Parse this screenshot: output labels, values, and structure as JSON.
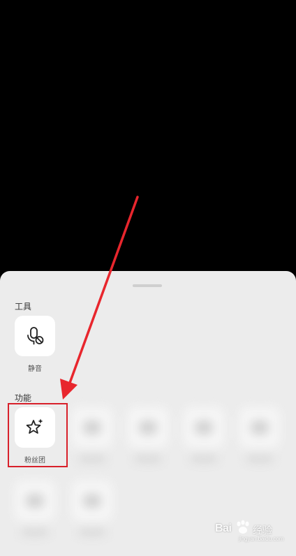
{
  "sheet": {
    "tools_heading": "工具",
    "functions_heading": "功能",
    "tools": [
      {
        "label": "静音",
        "icon": "mute-mic-icon"
      }
    ],
    "functions": [
      {
        "label": "粉丝团",
        "icon": "star-sparkle-icon"
      }
    ]
  },
  "annotation": {
    "arrow_color": "#e8262d",
    "highlight_color": "#d8202a"
  },
  "watermark": {
    "brand": "Bai",
    "brand_suffix": "经验",
    "url": "jingyan.baidu.com"
  }
}
